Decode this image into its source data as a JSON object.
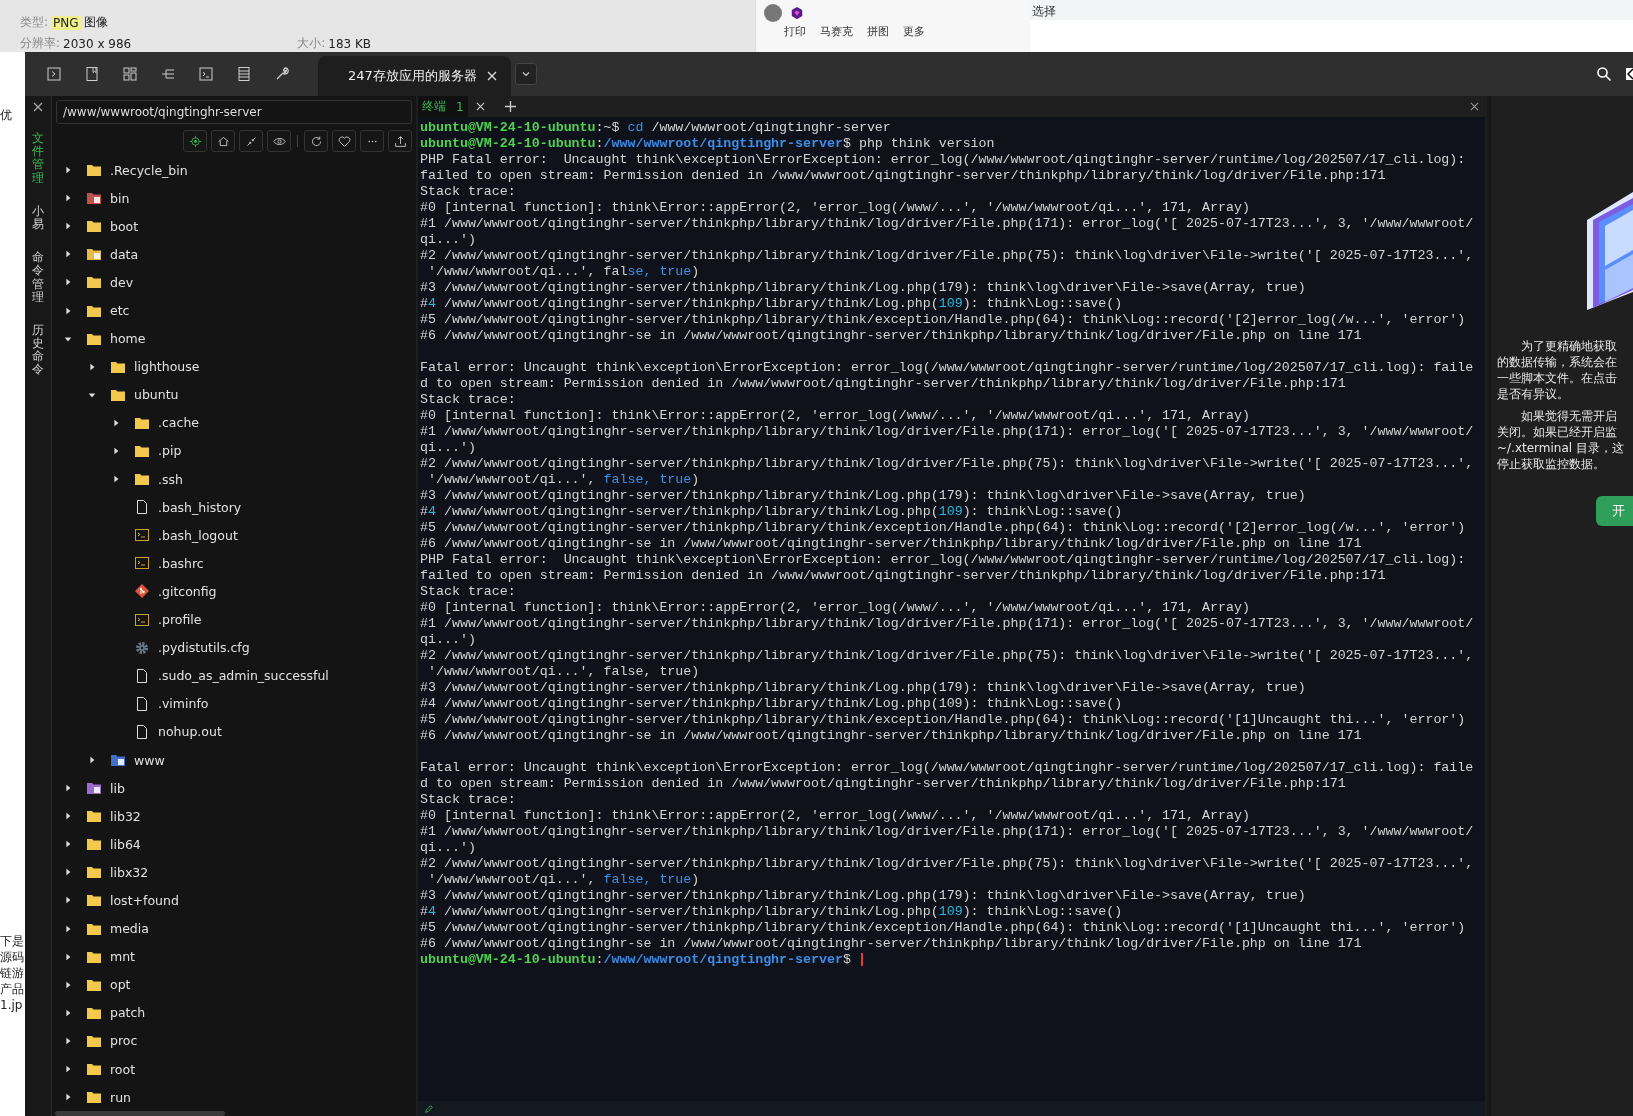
{
  "viewer_info": {
    "type_label": "类型:",
    "type_value": "PNG",
    "type_suffix": "图像",
    "resolution_label": "分辨率:",
    "resolution_value": "2030 x 986",
    "size_label": "大小:",
    "size_value": "183 KB"
  },
  "popup_toolbar": [
    "打印",
    "马赛克",
    "拼图",
    "更多"
  ],
  "select_label": "选择",
  "background_fragments": [
    "优",
    "下是",
    "源码",
    "链游",
    "产品",
    "1.jp"
  ],
  "session_tab": {
    "title": "247存放应用的服务器",
    "selected": true
  },
  "side_tabs": [
    {
      "label": "文件管理",
      "selected": true
    },
    {
      "label": "小易",
      "selected": false
    },
    {
      "label": "命令管理",
      "selected": false
    },
    {
      "label": "历史命令",
      "selected": false
    }
  ],
  "file_panel": {
    "path": "/www/wwwroot/qingtinghr-server",
    "tree": [
      {
        "name": ".Recycle_bin",
        "kind": "folder",
        "expanded": false
      },
      {
        "name": "bin",
        "kind": "bin-folder",
        "expanded": false
      },
      {
        "name": "boot",
        "kind": "folder",
        "expanded": false
      },
      {
        "name": "data",
        "kind": "data-folder",
        "expanded": false
      },
      {
        "name": "dev",
        "kind": "folder",
        "expanded": false
      },
      {
        "name": "etc",
        "kind": "folder",
        "expanded": false
      },
      {
        "name": "home",
        "kind": "folder",
        "expanded": true,
        "children": [
          {
            "name": "lighthouse",
            "kind": "folder",
            "expanded": false
          },
          {
            "name": "ubuntu",
            "kind": "folder",
            "expanded": true,
            "children": [
              {
                "name": ".cache",
                "kind": "folder",
                "expanded": false
              },
              {
                "name": ".pip",
                "kind": "folder",
                "expanded": false
              },
              {
                "name": ".ssh",
                "kind": "folder",
                "expanded": false
              },
              {
                "name": ".bash_history",
                "kind": "file"
              },
              {
                "name": ".bash_logout",
                "kind": "script"
              },
              {
                "name": ".bashrc",
                "kind": "script"
              },
              {
                "name": ".gitconfig",
                "kind": "git"
              },
              {
                "name": ".profile",
                "kind": "script"
              },
              {
                "name": ".pydistutils.cfg",
                "kind": "config"
              },
              {
                "name": ".sudo_as_admin_successful",
                "kind": "file"
              },
              {
                "name": ".viminfo",
                "kind": "file"
              },
              {
                "name": "nohup.out",
                "kind": "file"
              }
            ]
          },
          {
            "name": "www",
            "kind": "link-folder",
            "expanded": false
          }
        ]
      },
      {
        "name": "lib",
        "kind": "lib-folder",
        "expanded": false
      },
      {
        "name": "lib32",
        "kind": "folder",
        "expanded": false
      },
      {
        "name": "lib64",
        "kind": "folder",
        "expanded": false
      },
      {
        "name": "libx32",
        "kind": "folder",
        "expanded": false
      },
      {
        "name": "lost+found",
        "kind": "folder",
        "expanded": false
      },
      {
        "name": "media",
        "kind": "folder",
        "expanded": false
      },
      {
        "name": "mnt",
        "kind": "folder",
        "expanded": false
      },
      {
        "name": "opt",
        "kind": "folder",
        "expanded": false
      },
      {
        "name": "patch",
        "kind": "folder",
        "expanded": false
      },
      {
        "name": "proc",
        "kind": "folder",
        "expanded": false
      },
      {
        "name": "root",
        "kind": "folder",
        "expanded": false
      },
      {
        "name": "run",
        "kind": "folder",
        "expanded": false
      }
    ]
  },
  "terminal": {
    "tab": {
      "label": "终端",
      "number": "1",
      "selected": true
    },
    "cursor_visible": true,
    "rows": [
      {
        "gap": false,
        "segments": [
          {
            "text": "ubuntu@VM-24-10-ubuntu",
            "kind": "user"
          },
          {
            "text": ":~$ ",
            "kind": "plain"
          },
          {
            "text": "cd",
            "kind": "command"
          },
          {
            "text": " /www/wwwroot/qingtinghr-server",
            "kind": "plain"
          }
        ]
      },
      {
        "gap": false,
        "segments": [
          {
            "text": "ubuntu@VM-24-10-ubuntu",
            "kind": "user"
          },
          {
            "text": ":",
            "kind": "plain"
          },
          {
            "text": "/www/wwwroot/qingtinghr-server",
            "kind": "path"
          },
          {
            "text": "$ php think version",
            "kind": "plain"
          }
        ]
      },
      {
        "gap": false,
        "segments": [
          {
            "text": "PHP Fatal error:  Uncaught think\\exception\\ErrorException: error_log(/www/wwwroot/qingtinghr-server/runtime/log/202507/17_cli.log):",
            "kind": "plain"
          }
        ]
      },
      {
        "gap": false,
        "segments": [
          {
            "text": "failed to open stream: Permission denied in /www/wwwroot/qingtinghr-server/thinkphp/library/think/log/driver/File.php:171",
            "kind": "plain"
          }
        ]
      },
      {
        "gap": false,
        "segments": [
          {
            "text": "Stack trace:",
            "kind": "plain"
          }
        ]
      },
      {
        "gap": false,
        "segments": [
          {
            "text": "#0 [internal function]: think\\Error::appError(2, 'error_log(/www/...', '/www/wwwroot/qi...', 171, Array)",
            "kind": "plain"
          }
        ]
      },
      {
        "gap": false,
        "segments": [
          {
            "text": "#1 /www/wwwroot/qingtinghr-server/thinkphp/library/think/log/driver/File.php(171): error_log('[ 2025-07-17T23...', 3, '/www/wwwroot/",
            "kind": "plain"
          }
        ]
      },
      {
        "gap": false,
        "segments": [
          {
            "text": "qi...')",
            "kind": "plain"
          }
        ]
      },
      {
        "gap": false,
        "segments": [
          {
            "text": "#2 /www/wwwroot/qingtinghr-server/thinkphp/library/think/log/driver/File.php(75): think\\log\\driver\\File->write('[ 2025-07-17T23...',",
            "kind": "plain"
          }
        ]
      },
      {
        "gap": false,
        "segments": [
          {
            "text": " '/www/wwwroot/qi...', fal",
            "kind": "plain"
          },
          {
            "text": "se, true",
            "kind": "keyword"
          },
          {
            "text": ")",
            "kind": "plain"
          }
        ]
      },
      {
        "gap": false,
        "segments": [
          {
            "text": "#3 /www/wwwroot/qingtinghr-server/thinkphp/library/think/Log.php(179): think\\log\\driver\\File->save(Array, true)",
            "kind": "plain"
          }
        ]
      },
      {
        "gap": false,
        "segments": [
          {
            "text": "#",
            "kind": "plain"
          },
          {
            "text": "4",
            "kind": "number"
          },
          {
            "text": " /www/wwwroot/qingtinghr-server/thinkphp/library/think/Log.php(",
            "kind": "plain"
          },
          {
            "text": "109",
            "kind": "number"
          },
          {
            "text": "): think\\Log::save()",
            "kind": "plain"
          }
        ]
      },
      {
        "gap": false,
        "segments": [
          {
            "text": "#5 /www/wwwroot/qingtinghr-server/thinkphp/library/think/exception/Handle.php(64): think\\Log::record('[2]error_log(/w...', 'error')",
            "kind": "plain"
          }
        ]
      },
      {
        "gap": false,
        "segments": [
          {
            "text": "#6 /www/wwwroot/qingtinghr-se in /www/wwwroot/qingtinghr-server/thinkphp/library/think/log/driver/File.php on line 171",
            "kind": "plain"
          }
        ]
      },
      {
        "gap": true,
        "segments": [
          {
            "text": "Fatal error: Uncaught think\\exception\\ErrorException: error_log(/www/wwwroot/qingtinghr-server/runtime/log/202507/17_cli.log): faile",
            "kind": "plain"
          }
        ]
      },
      {
        "gap": false,
        "segments": [
          {
            "text": "d to open stream: Permission denied in /www/wwwroot/qingtinghr-server/thinkphp/library/think/log/driver/File.php:171",
            "kind": "plain"
          }
        ]
      },
      {
        "gap": false,
        "segments": [
          {
            "text": "Stack trace:",
            "kind": "plain"
          }
        ]
      },
      {
        "gap": false,
        "segments": [
          {
            "text": "#0 [internal function]: think\\Error::appError(2, 'error_log(/www/...', '/www/wwwroot/qi...', 171, Array)",
            "kind": "plain"
          }
        ]
      },
      {
        "gap": false,
        "segments": [
          {
            "text": "#1 /www/wwwroot/qingtinghr-server/thinkphp/library/think/log/driver/File.php(171): error_log('[ 2025-07-17T23...', 3, '/www/wwwroot/",
            "kind": "plain"
          }
        ]
      },
      {
        "gap": false,
        "segments": [
          {
            "text": "qi...')",
            "kind": "plain"
          }
        ]
      },
      {
        "gap": false,
        "segments": [
          {
            "text": "#2 /www/wwwroot/qingtinghr-server/thinkphp/library/think/log/driver/File.php(75): think\\log\\driver\\File->write('[ 2025-07-17T23...',",
            "kind": "plain"
          }
        ]
      },
      {
        "gap": false,
        "segments": [
          {
            "text": " '/www/wwwroot/qi...', ",
            "kind": "plain"
          },
          {
            "text": "false, true",
            "kind": "keyword"
          },
          {
            "text": ")",
            "kind": "plain"
          }
        ]
      },
      {
        "gap": false,
        "segments": [
          {
            "text": "#3 /www/wwwroot/qingtinghr-server/thinkphp/library/think/Log.php(179): think\\log\\driver\\File->save(Array, true)",
            "kind": "plain"
          }
        ]
      },
      {
        "gap": false,
        "segments": [
          {
            "text": "#",
            "kind": "plain"
          },
          {
            "text": "4",
            "kind": "number"
          },
          {
            "text": " /www/wwwroot/qingtinghr-server/thinkphp/library/think/Log.php(",
            "kind": "plain"
          },
          {
            "text": "109",
            "kind": "number"
          },
          {
            "text": "): think\\Log::save()",
            "kind": "plain"
          }
        ]
      },
      {
        "gap": false,
        "segments": [
          {
            "text": "#5 /www/wwwroot/qingtinghr-server/thinkphp/library/think/exception/Handle.php(64): think\\Log::record('[2]error_log(/w...', 'error')",
            "kind": "plain"
          }
        ]
      },
      {
        "gap": false,
        "segments": [
          {
            "text": "#6 /www/wwwroot/qingtinghr-se in /www/wwwroot/qingtinghr-server/thinkphp/library/think/log/driver/File.php on line 171",
            "kind": "plain"
          }
        ]
      },
      {
        "gap": false,
        "segments": [
          {
            "text": "PHP Fatal error:  Uncaught think\\exception\\ErrorException: error_log(/www/wwwroot/qingtinghr-server/runtime/log/202507/17_cli.log):",
            "kind": "plain"
          }
        ]
      },
      {
        "gap": false,
        "segments": [
          {
            "text": "failed to open stream: Permission denied in /www/wwwroot/qingtinghr-server/thinkphp/library/think/log/driver/File.php:171",
            "kind": "plain"
          }
        ]
      },
      {
        "gap": false,
        "segments": [
          {
            "text": "Stack trace:",
            "kind": "plain"
          }
        ]
      },
      {
        "gap": false,
        "segments": [
          {
            "text": "#0 [internal function]: think\\Error::appError(2, 'error_log(/www/...', '/www/wwwroot/qi...', 171, Array)",
            "kind": "plain"
          }
        ]
      },
      {
        "gap": false,
        "segments": [
          {
            "text": "#1 /www/wwwroot/qingtinghr-server/thinkphp/library/think/log/driver/File.php(171): error_log('[ 2025-07-17T23...', 3, '/www/wwwroot/",
            "kind": "plain"
          }
        ]
      },
      {
        "gap": false,
        "segments": [
          {
            "text": "qi...')",
            "kind": "plain"
          }
        ]
      },
      {
        "gap": false,
        "segments": [
          {
            "text": "#2 /www/wwwroot/qingtinghr-server/thinkphp/library/think/log/driver/File.php(75): think\\log\\driver\\File->write('[ 2025-07-17T23...',",
            "kind": "plain"
          }
        ]
      },
      {
        "gap": false,
        "segments": [
          {
            "text": " '/www/wwwroot/qi...', false, true)",
            "kind": "plain"
          }
        ]
      },
      {
        "gap": false,
        "segments": [
          {
            "text": "#3 /www/wwwroot/qingtinghr-server/thinkphp/library/think/Log.php(179): think\\log\\driver\\File->save(Array, true)",
            "kind": "plain"
          }
        ]
      },
      {
        "gap": false,
        "segments": [
          {
            "text": "#4 /www/wwwroot/qingtinghr-server/thinkphp/library/think/Log.php(109): think\\Log::save()",
            "kind": "plain"
          }
        ]
      },
      {
        "gap": false,
        "segments": [
          {
            "text": "#5 /www/wwwroot/qingtinghr-server/thinkphp/library/think/exception/Handle.php(64): think\\Log::record('[1]Uncaught thi...', 'error')",
            "kind": "plain"
          }
        ]
      },
      {
        "gap": false,
        "segments": [
          {
            "text": "#6 /www/wwwroot/qingtinghr-se in /www/wwwroot/qingtinghr-server/thinkphp/library/think/log/driver/File.php on line 171",
            "kind": "plain"
          }
        ]
      },
      {
        "gap": true,
        "segments": [
          {
            "text": "Fatal error: Uncaught think\\exception\\ErrorException: error_log(/www/wwwroot/qingtinghr-server/runtime/log/202507/17_cli.log): faile",
            "kind": "plain"
          }
        ]
      },
      {
        "gap": false,
        "segments": [
          {
            "text": "d to open stream: Permission denied in /www/wwwroot/qingtinghr-server/thinkphp/library/think/log/driver/File.php:171",
            "kind": "plain"
          }
        ]
      },
      {
        "gap": false,
        "segments": [
          {
            "text": "Stack trace:",
            "kind": "plain"
          }
        ]
      },
      {
        "gap": false,
        "segments": [
          {
            "text": "#0 [internal function]: think\\Error::appError(2, 'error_log(/www/...', '/www/wwwroot/qi...', 171, Array)",
            "kind": "plain"
          }
        ]
      },
      {
        "gap": false,
        "segments": [
          {
            "text": "#1 /www/wwwroot/qingtinghr-server/thinkphp/library/think/log/driver/File.php(171): error_log('[ 2025-07-17T23...', 3, '/www/wwwroot/",
            "kind": "plain"
          }
        ]
      },
      {
        "gap": false,
        "segments": [
          {
            "text": "qi...')",
            "kind": "plain"
          }
        ]
      },
      {
        "gap": false,
        "segments": [
          {
            "text": "#2 /www/wwwroot/qingtinghr-server/thinkphp/library/think/log/driver/File.php(75): think\\log\\driver\\File->write('[ 2025-07-17T23...',",
            "kind": "plain"
          }
        ]
      },
      {
        "gap": false,
        "segments": [
          {
            "text": " '/www/wwwroot/qi...', ",
            "kind": "plain"
          },
          {
            "text": "false, true",
            "kind": "keyword"
          },
          {
            "text": ")",
            "kind": "plain"
          }
        ]
      },
      {
        "gap": false,
        "segments": [
          {
            "text": "#3 /www/wwwroot/qingtinghr-server/thinkphp/library/think/Log.php(179): think\\log\\driver\\File->save(Array, true)",
            "kind": "plain"
          }
        ]
      },
      {
        "gap": false,
        "segments": [
          {
            "text": "#",
            "kind": "plain"
          },
          {
            "text": "4",
            "kind": "number"
          },
          {
            "text": " /www/wwwroot/qingtinghr-server/thinkphp/library/think/Log.php(",
            "kind": "plain"
          },
          {
            "text": "109",
            "kind": "number"
          },
          {
            "text": "): think\\Log::save()",
            "kind": "plain"
          }
        ]
      },
      {
        "gap": false,
        "segments": [
          {
            "text": "#5 /www/wwwroot/qingtinghr-server/thinkphp/library/think/exception/Handle.php(64): think\\Log::record('[1]Uncaught thi...', 'error')",
            "kind": "plain"
          }
        ]
      },
      {
        "gap": false,
        "segments": [
          {
            "text": "#6 /www/wwwroot/qingtinghr-se in /www/wwwroot/qingtinghr-server/thinkphp/library/think/log/driver/File.php on line 171",
            "kind": "plain"
          }
        ]
      },
      {
        "gap": false,
        "segments": [
          {
            "text": "ubuntu@VM-24-10-ubuntu",
            "kind": "user"
          },
          {
            "text": ":",
            "kind": "plain"
          },
          {
            "text": "/www/wwwroot/qingtinghr-server",
            "kind": "path"
          },
          {
            "text": "$ ",
            "kind": "plain"
          }
        ]
      }
    ]
  },
  "monitor_panel": {
    "paragraphs": [
      [
        "为了更精确地获取",
        "的数据传输，系统会在",
        "一些脚本文件。在点击",
        "是否有异议。"
      ],
      [
        "如果觉得无需开启",
        "关闭。如果已经开启监",
        "~/.xterminal 目录，这",
        "停止获取监控数据。"
      ]
    ],
    "button": "开"
  }
}
